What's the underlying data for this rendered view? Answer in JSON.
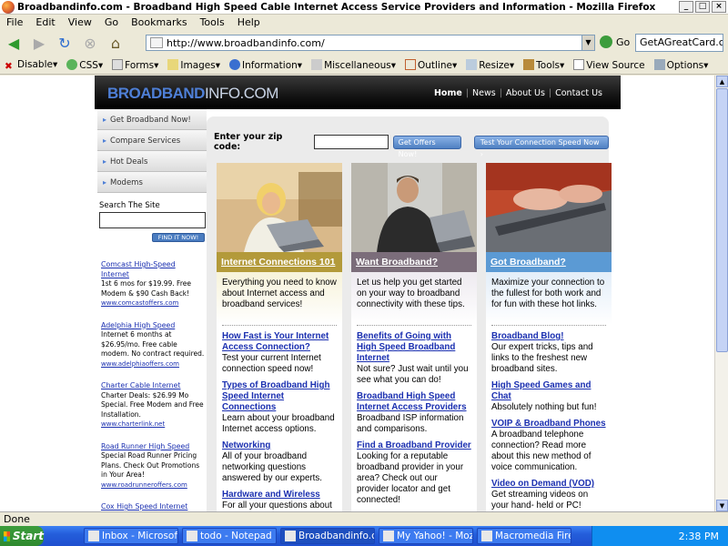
{
  "window": {
    "title": "Broadbandinfo.com - Broadband High Speed Cable Internet Access Service Providers and Information - Mozilla Firefox"
  },
  "menu": [
    "File",
    "Edit",
    "View",
    "Go",
    "Bookmarks",
    "Tools",
    "Help"
  ],
  "nav": {
    "url": "http://www.broadbandinfo.com/",
    "go_label": "Go",
    "search_value": "GetAGreatCard.com"
  },
  "webdev_toolbar": [
    "Disable▾",
    "CSS▾",
    "Forms▾",
    "Images▾",
    "Information▾",
    "Miscellaneous▾",
    "Outline▾",
    "Resize▾",
    "Tools▾",
    "View Source",
    "Options▾"
  ],
  "site": {
    "logo_a": "BROADBAND",
    "logo_b": "INFO.COM",
    "topnav": [
      "Home",
      "News",
      "About Us",
      "Contact Us"
    ],
    "sidenav": [
      "Get Broadband Now!",
      "Compare Services",
      "Hot Deals",
      "Modems"
    ],
    "search_label": "Search The Site",
    "find_label": "FIND IT NOW!",
    "promos": [
      {
        "title": "Comcast High-Speed Internet",
        "body": "1st 6 mos for $19.99. Free Modem & $90 Cash Back!",
        "url": "www.comcastoffers.com"
      },
      {
        "title": "Adelphia High Speed",
        "body": "Internet 6 months at $26.95/mo. Free cable modem. No contract required.",
        "url": "www.adelphiaoffers.com"
      },
      {
        "title": "Charter Cable Internet",
        "body": "Charter Deals: $26.99 Mo Special. Free Modem and Free Installation.",
        "url": "www.charterlink.net"
      },
      {
        "title": "Road Runner High Speed",
        "body": "Special Road Runner Pricing Plans. Check Out Promotions in Your Area!",
        "url": "www.roadrunneroffers.com"
      },
      {
        "title": "Cox High Speed Internet",
        "body": "",
        "url": ""
      }
    ],
    "zip_label": "Enter your zip code:",
    "offers_btn": "Get Offers Now!",
    "speed_btn": "Test Your Connection Speed Now ›",
    "columns": [
      {
        "title": "Internet Connections 101",
        "intro": "Everything you need to know about Internet access and broadband services!",
        "items": [
          {
            "link": "How Fast is Your Internet Access Connection?",
            "text": "Test your current Internet connection speed now!"
          },
          {
            "link": "Types of Broadband High Speed Internet Connections",
            "text": "Learn about your broadband Internet access options."
          },
          {
            "link": "Networking",
            "text": "All of your broadband networking questions answered by our experts."
          },
          {
            "link": "Hardware and Wireless",
            "text": "For all your questions about"
          }
        ]
      },
      {
        "title": "Want Broadband?",
        "intro": "Let us help you get started on your way to broadband connectivity with these tips.",
        "items": [
          {
            "link": "Benefits of Going with High Speed Broadband Internet",
            "text": "Not sure? Just wait until you see what you can do!"
          },
          {
            "link": "Broadband High Speed Internet Access Providers",
            "text": "Broadband ISP information and comparisons."
          },
          {
            "link": "Find a Broadband Provider",
            "text": "Looking for a reputable broadband provider in your area?  Check out our provider locator and get connected!"
          }
        ]
      },
      {
        "title": "Got Broadband?",
        "intro": "Maximize your connection to the fullest for both work and for fun with these hot links.",
        "items": [
          {
            "link": "Broadband Blog!",
            "text": "Our expert tricks, tips and links to the freshest new broadband sites."
          },
          {
            "link": "High Speed Games and Chat",
            "text": "Absolutely nothing but fun!"
          },
          {
            "link": "VOIP & Broadband Phones",
            "text": "A broadband telephone connection?  Read more about this new method of voice communication."
          },
          {
            "link": "Video on Demand (VOD)",
            "text": "Get streaming videos on your hand- held or PC!"
          }
        ]
      }
    ]
  },
  "status": "Done",
  "taskbar": {
    "start": "Start",
    "tasks": [
      "Inbox - Microsoft O...",
      "todo - Notepad",
      "Broadbandinfo.co...",
      "My Yahoo! - Mozilla ...",
      "Macromedia Firewor..."
    ],
    "time": "2:38 PM"
  }
}
